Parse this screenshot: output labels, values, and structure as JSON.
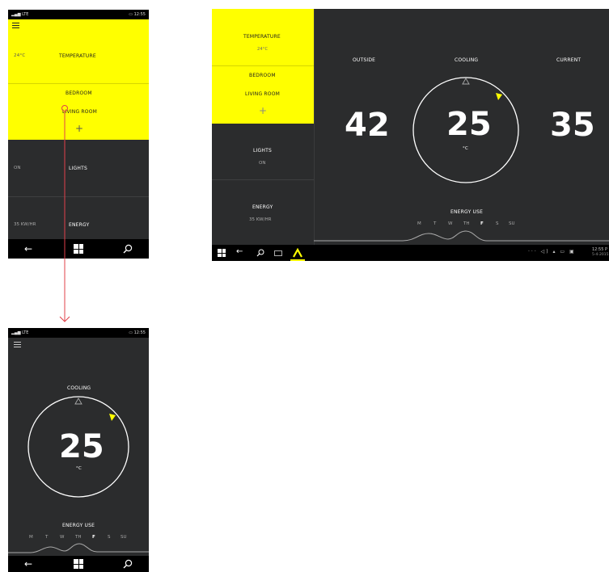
{
  "phone_home": {
    "status_signal": "▂▄▆ LTE",
    "status_time": "12:55",
    "menu_icon": "hamburger-icon",
    "temp_value": "24°C",
    "temp_label": "TEMPERATURE",
    "room_bedroom": "BEDROOM",
    "room_living": "LIVING ROOM",
    "add_symbol": "+",
    "lights_state": "ON",
    "lights_label": "LIGHTS",
    "energy_value": "35 KW/HR",
    "energy_label": "ENERGY"
  },
  "tablet": {
    "sidebar": {
      "temp_label": "TEMPERATURE",
      "temp_value": "24°C",
      "room_bedroom": "BEDROOM",
      "room_living": "LIVING ROOM",
      "add_symbol": "+",
      "lights_label": "LIGHTS",
      "lights_state": "ON",
      "energy_label": "ENERGY",
      "energy_value": "35 KW/HR"
    },
    "outside_label": "OUTSIDE",
    "outside_value": "42",
    "mode_label": "COOLING",
    "setpoint_value": "25",
    "setpoint_unit": "°C",
    "current_label": "CURRENT",
    "current_value": "35",
    "energy_use_label": "ENERGY USE",
    "days": [
      "M",
      "T",
      "W",
      "TH",
      "F",
      "S",
      "SU"
    ],
    "active_day": "F",
    "tray_time": "12:55 P",
    "tray_date": "5-4-2015"
  },
  "phone_detail": {
    "status_signal": "▂▄▆ LTE",
    "status_time": "12:55",
    "mode_label": "COOLING",
    "setpoint_value": "25",
    "setpoint_unit": "°C",
    "energy_use_label": "ENERGY USE",
    "days": [
      "M",
      "T",
      "W",
      "TH",
      "F",
      "S",
      "SU"
    ],
    "active_day": "F"
  },
  "colors": {
    "accent_yellow": "#ffff00",
    "panel_dark": "#2b2c2d",
    "flow_arrow": "#e0414a"
  }
}
